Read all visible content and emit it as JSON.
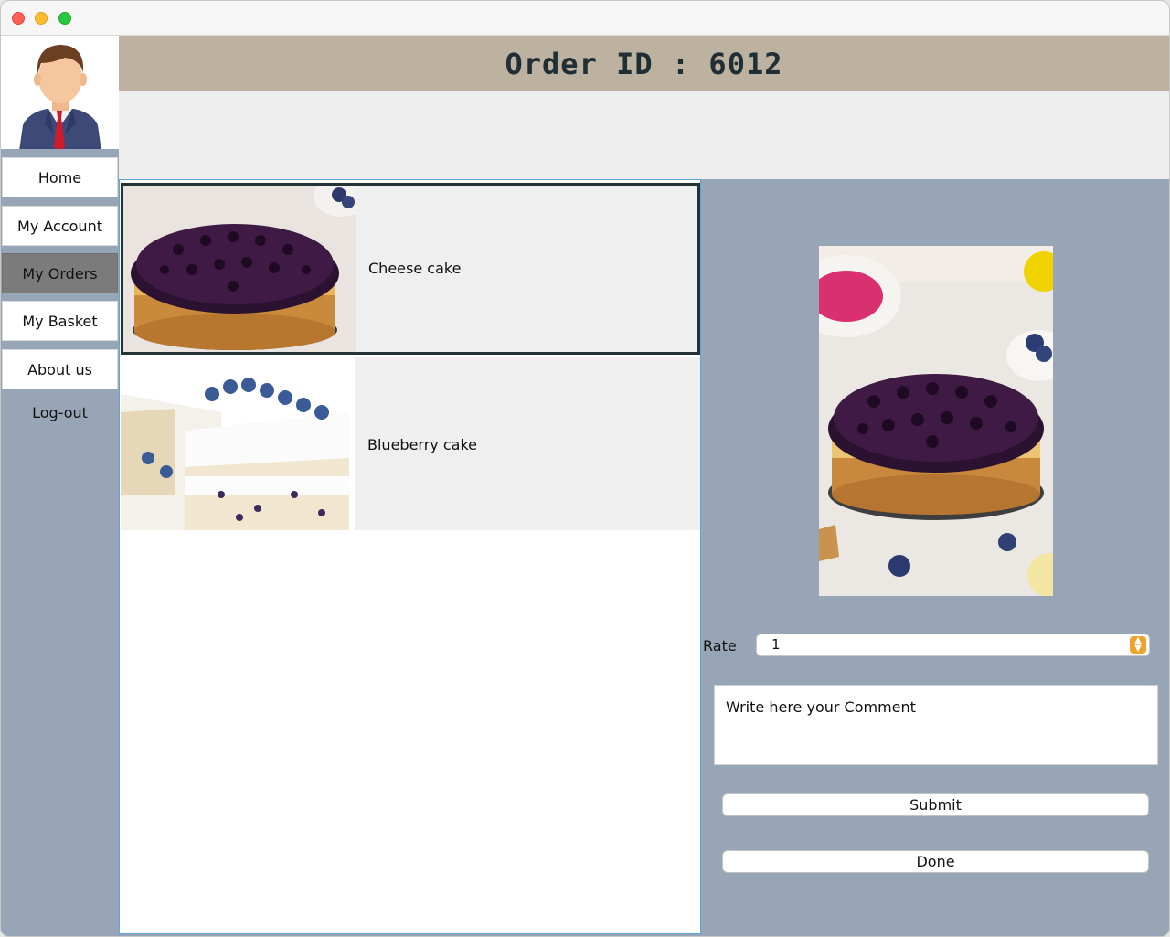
{
  "window": {
    "controls": [
      "close-icon",
      "minimize-icon",
      "zoom-icon"
    ]
  },
  "sidebar": {
    "avatar_icon": "businessman-avatar-icon",
    "items": [
      {
        "label": "Home",
        "active": false
      },
      {
        "label": "My Account",
        "active": false
      },
      {
        "label": "My Orders",
        "active": true
      },
      {
        "label": "My Basket",
        "active": false
      },
      {
        "label": "About us",
        "active": false
      },
      {
        "label": "Log-out",
        "active": false
      }
    ]
  },
  "header": {
    "title": "Order ID : 6012"
  },
  "order_items": [
    {
      "name": "Cheese cake",
      "selected": true,
      "image": "blueberry-cheesecake-photo"
    },
    {
      "name": "Blueberry cake",
      "selected": false,
      "image": "blueberry-layer-cake-photo"
    }
  ],
  "details": {
    "preview_image": "blueberry-cheesecake-photo",
    "rate_label": "Rate",
    "rate_value": "1",
    "comment_placeholder": "Write here your Comment",
    "submit_label": "Submit",
    "done_label": "Done"
  },
  "colors": {
    "header_bg": "#bdb29f",
    "sidebar_bg": "#98a5b6",
    "active_nav": "#7b7b7b",
    "selection_border": "#253238",
    "select_accent": "#f0a32a"
  }
}
